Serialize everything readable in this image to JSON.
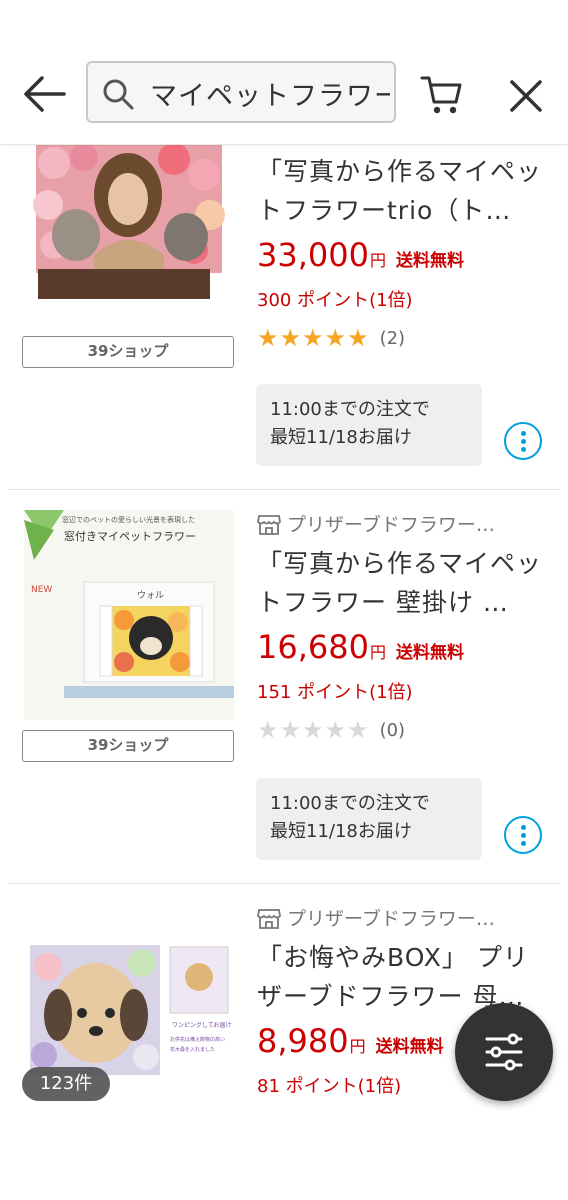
{
  "header": {
    "search_value": "マイペットフラワー",
    "icons": [
      "back-arrow-icon",
      "search-icon",
      "cart-icon",
      "close-icon"
    ]
  },
  "products": [
    {
      "title": "「写真から作るマイペットフラワーtrio（ト…",
      "price": "33,000",
      "yen": "円",
      "shipping": "送料無料",
      "points": "300 ポイント(1倍)",
      "rating_stars": 5,
      "rating_count": "(2)",
      "shop": "39ショップ",
      "delivery_line1": "11:00までの注文で",
      "delivery_line2": "最短11/18お届け"
    },
    {
      "seller": "プリザーブドフラワー…",
      "title": "「写真から作るマイペットフラワー 壁掛け …",
      "price": "16,680",
      "yen": "円",
      "shipping": "送料無料",
      "points": "151 ポイント(1倍)",
      "rating_stars": 0,
      "rating_count": "(0)",
      "shop": "39ショップ",
      "delivery_line1": "11:00までの注文で",
      "delivery_line2": "最短11/18お届け",
      "image_text": {
        "caption": "窓辺でのペットの愛らしい光景を表現した",
        "headline": "窓付きマイペットフラワー",
        "badge": "NEW",
        "name_plate": "ウォル"
      }
    },
    {
      "seller": "プリザーブドフラワー…",
      "title": "「お悔やみBOX」 プリザーブドフラワー 母…",
      "price": "8,980",
      "yen": "円",
      "shipping": "送料無料",
      "points": "81 ポイント(1倍)",
      "image_text": {
        "line1": "ワンピングしてお届け",
        "line2": "お供花は備え飾物の高い",
        "line3": "花木桑を入れました"
      }
    }
  ],
  "result_count": "123件",
  "colors": {
    "price_red": "#cc0000",
    "star_gold": "#f5a623",
    "star_empty": "#d8d8d8",
    "accent_blue": "#00a0e0"
  }
}
